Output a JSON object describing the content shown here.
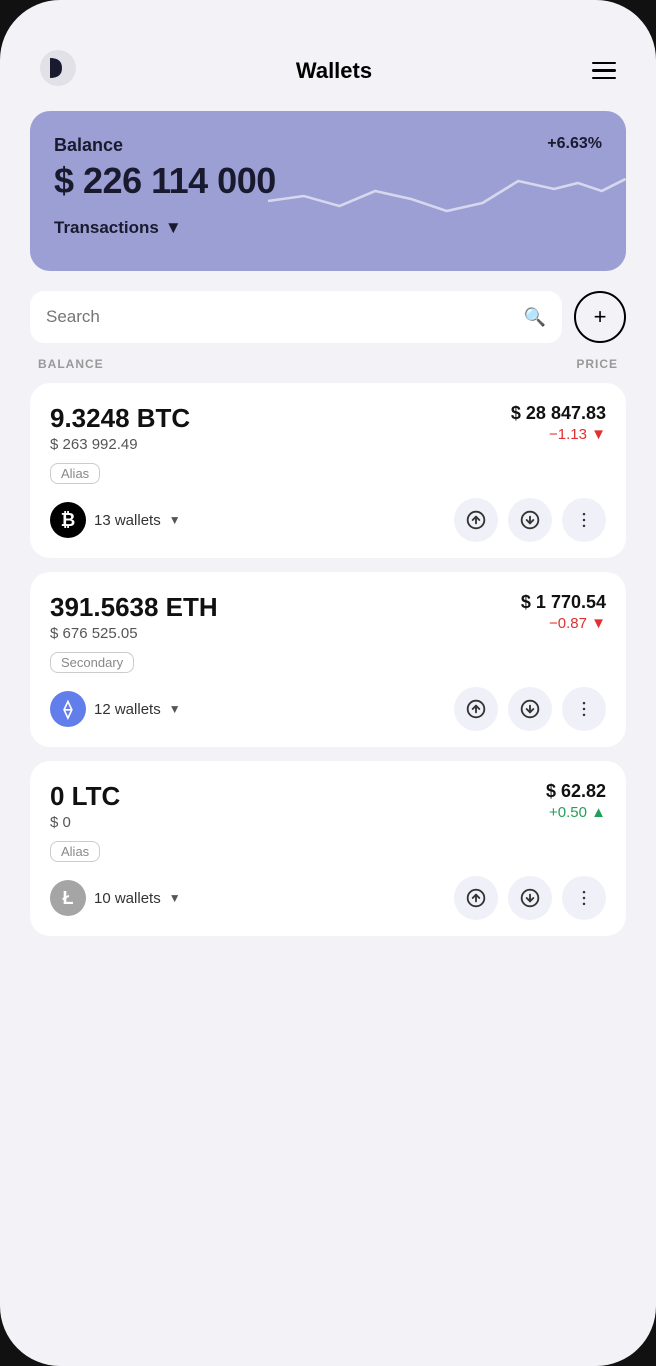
{
  "app": {
    "title": "Wallets"
  },
  "header": {
    "title": "Wallets",
    "menu_label": "Menu"
  },
  "balance_card": {
    "label": "Balance",
    "percent": "+6.63%",
    "amount": "$ 226 114 000",
    "transactions_label": "Transactions"
  },
  "search": {
    "placeholder": "Search",
    "add_label": "+"
  },
  "list_headers": {
    "balance": "BALANCE",
    "price": "PRICE"
  },
  "coins": [
    {
      "amount": "9.3248 BTC",
      "usd_value": "$ 263 992.49",
      "alias": "Alias",
      "wallets_count": "13 wallets",
      "price": "$ 28 847.83",
      "change": "−1.13 ▼",
      "change_type": "negative",
      "logo_symbol": "₿",
      "logo_class": "btc"
    },
    {
      "amount": "391.5638 ETH",
      "usd_value": "$ 676 525.05",
      "alias": "Secondary",
      "wallets_count": "12 wallets",
      "price": "$ 1 770.54",
      "change": "−0.87 ▼",
      "change_type": "negative",
      "logo_symbol": "⟠",
      "logo_class": "eth"
    },
    {
      "amount": "0 LTC",
      "usd_value": "$ 0",
      "alias": "Alias",
      "wallets_count": "10 wallets",
      "price": "$ 62.82",
      "change": "+0.50 ▲",
      "change_type": "positive",
      "logo_symbol": "Ł",
      "logo_class": "ltc"
    }
  ]
}
